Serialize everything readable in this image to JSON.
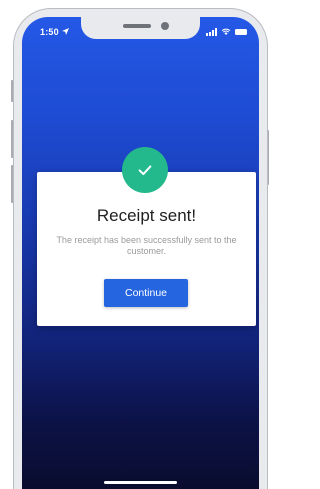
{
  "status_bar": {
    "time": "1:50",
    "location_icon": "location-arrow-icon",
    "signal_icon": "cellular-signal-icon",
    "wifi_icon": "wifi-icon",
    "battery_icon": "battery-icon"
  },
  "dialog": {
    "icon": "checkmark-icon",
    "title": "Receipt sent!",
    "message": "The receipt has been successfully sent to the customer.",
    "continue_label": "Continue"
  },
  "colors": {
    "gradient_top": "#2458e6",
    "gradient_bottom": "#0a0c2e",
    "success": "#23b98c",
    "primary_button": "#2565e0"
  }
}
